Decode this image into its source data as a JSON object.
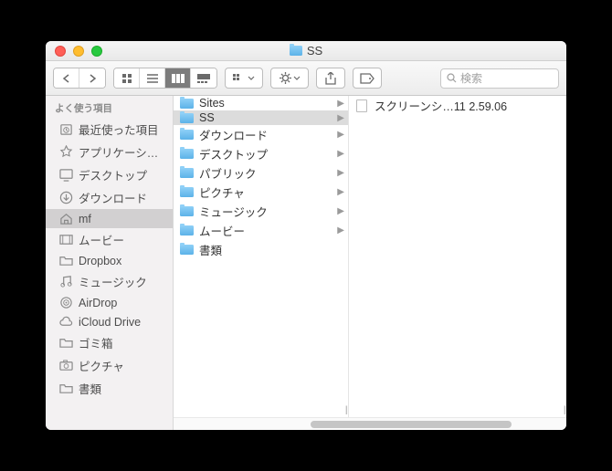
{
  "window": {
    "title": "SS"
  },
  "toolbar": {
    "search_placeholder": "検索"
  },
  "sidebar": {
    "header": "よく使う項目",
    "items": [
      {
        "label": "最近使った項目",
        "icon": "clock"
      },
      {
        "label": "アプリケーシ…",
        "icon": "app"
      },
      {
        "label": "デスクトップ",
        "icon": "desktop"
      },
      {
        "label": "ダウンロード",
        "icon": "download"
      },
      {
        "label": "mf",
        "icon": "home",
        "selected": true
      },
      {
        "label": "ムービー",
        "icon": "movie"
      },
      {
        "label": "Dropbox",
        "icon": "folder"
      },
      {
        "label": "ミュージック",
        "icon": "music"
      },
      {
        "label": "AirDrop",
        "icon": "airdrop"
      },
      {
        "label": "iCloud Drive",
        "icon": "cloud"
      },
      {
        "label": "ゴミ箱",
        "icon": "folder"
      },
      {
        "label": "ピクチャ",
        "icon": "camera"
      },
      {
        "label": "書類",
        "icon": "folder"
      }
    ]
  },
  "column1": {
    "items": [
      {
        "label": "Sites",
        "has_children": true
      },
      {
        "label": "SS",
        "has_children": true,
        "selected": true
      },
      {
        "label": "ダウンロード",
        "has_children": true
      },
      {
        "label": "デスクトップ",
        "has_children": true
      },
      {
        "label": "パブリック",
        "has_children": true
      },
      {
        "label": "ピクチャ",
        "has_children": true
      },
      {
        "label": "ミュージック",
        "has_children": true
      },
      {
        "label": "ムービー",
        "has_children": true
      },
      {
        "label": "書類",
        "has_children": false
      }
    ]
  },
  "column2": {
    "items": [
      {
        "label": "スクリーンシ…11 2.59.06",
        "type": "file"
      }
    ]
  }
}
